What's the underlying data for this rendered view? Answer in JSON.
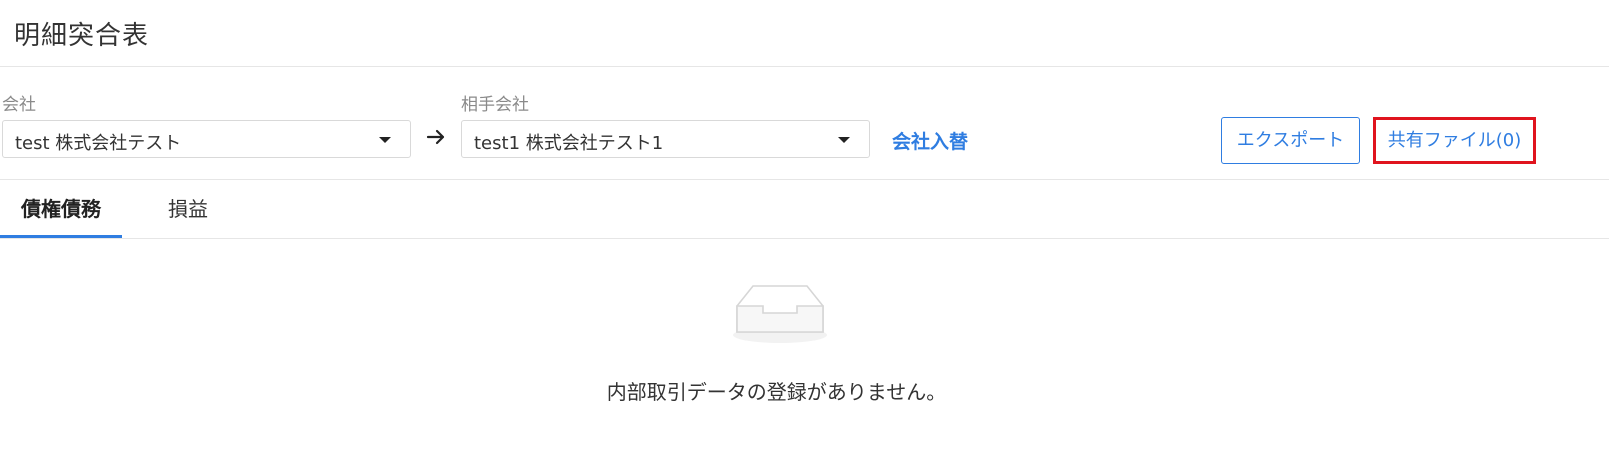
{
  "header": {
    "title": "明細突合表"
  },
  "filters": {
    "company_label": "会社",
    "company_value": "test 株式会社テスト",
    "partner_label": "相手会社",
    "partner_value": "test1 株式会社テスト1",
    "swap_link": "会社入替"
  },
  "actions": {
    "export_label": "エクスポート",
    "shared_files_label": "共有ファイル(0)"
  },
  "tabs": [
    {
      "label": "債権債務",
      "active": true
    },
    {
      "label": "損益",
      "active": false
    }
  ],
  "empty_state": {
    "message": "内部取引データの登録がありません。",
    "icon": "empty-inbox-icon"
  },
  "colors": {
    "accent": "#2f7de1",
    "highlight": "#e0141e",
    "border": "#d9d9d9"
  }
}
